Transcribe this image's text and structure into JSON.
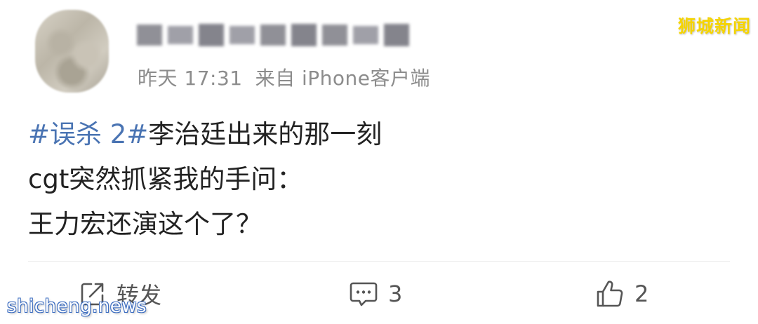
{
  "source_watermark": "狮城新闻",
  "site_watermark": "shicheng.news",
  "post": {
    "timestamp": "昨天 17:31",
    "client": "来自 iPhone客户端",
    "hashtag": "#误杀 2#",
    "lines": [
      "李治廷出来的那一刻",
      "cgt突然抓紧我的手问：",
      "王力宏还演这个了？"
    ]
  },
  "actions": {
    "repost_label": "转发",
    "comment_count": "3",
    "like_count": "2"
  },
  "colors": {
    "hashtag": "#4a74b3",
    "meta_text": "#8c8c8c",
    "body_text": "#222222",
    "watermark_top": "#f5d400"
  },
  "icons": {
    "repost": "share-edit-icon",
    "comment": "comment-bubble-icon",
    "like": "thumbs-up-icon"
  }
}
